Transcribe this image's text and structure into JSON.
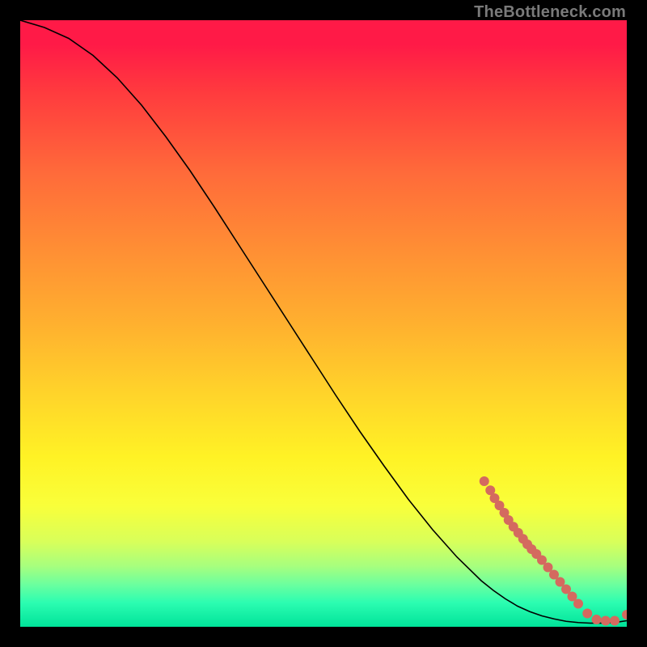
{
  "watermark": "TheBottleneck.com",
  "chart_data": {
    "type": "line",
    "title": "",
    "xlabel": "",
    "ylabel": "",
    "xlim": [
      0,
      100
    ],
    "ylim": [
      0,
      100
    ],
    "legend": false,
    "grid": false,
    "background": "heat-gradient-red-to-green-vertical",
    "series": [
      {
        "name": "curve",
        "style": "solid-black",
        "x": [
          0,
          4,
          8,
          12,
          16,
          20,
          24,
          28,
          32,
          36,
          40,
          44,
          48,
          52,
          56,
          60,
          64,
          68,
          72,
          76,
          78,
          80,
          82,
          84,
          86,
          88,
          90,
          92,
          94,
          96,
          98,
          100
        ],
        "y": [
          100,
          98.8,
          97.0,
          94.2,
          90.5,
          86.0,
          80.8,
          75.2,
          69.2,
          63.0,
          56.8,
          50.6,
          44.4,
          38.2,
          32.2,
          26.5,
          21.0,
          16.0,
          11.5,
          7.6,
          6.0,
          4.6,
          3.4,
          2.5,
          1.8,
          1.3,
          0.9,
          0.7,
          0.6,
          0.6,
          0.7,
          1.0
        ]
      },
      {
        "name": "cluster-points",
        "style": "scatter-coral",
        "marker_color": "#d46a5f",
        "marker_radius_px": 6,
        "x": [
          76.5,
          77.5,
          78.2,
          79.0,
          79.8,
          80.5,
          81.3,
          82.1,
          82.9,
          83.6,
          84.3,
          85.1,
          86.0,
          87.0,
          88.0,
          89.0,
          90.0,
          91.0,
          92.0,
          93.5,
          95.0,
          96.5,
          98.0,
          100.0
        ],
        "y": [
          24.0,
          22.5,
          21.2,
          20.0,
          18.8,
          17.6,
          16.5,
          15.5,
          14.5,
          13.6,
          12.8,
          12.0,
          11.0,
          9.8,
          8.6,
          7.4,
          6.2,
          5.0,
          3.8,
          2.2,
          1.2,
          1.0,
          1.0,
          2.0
        ]
      }
    ]
  }
}
